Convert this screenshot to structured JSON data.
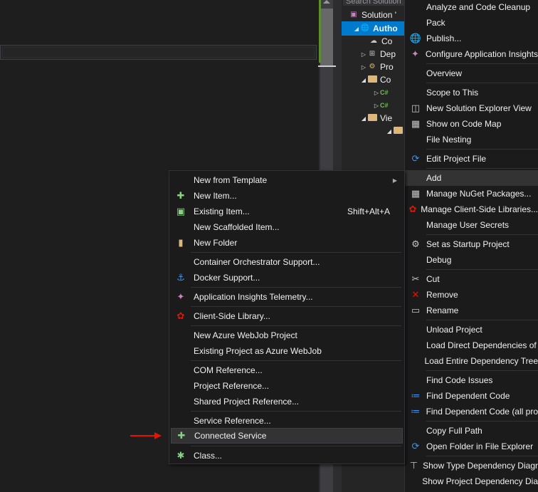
{
  "solution_explorer": {
    "search_placeholder": "Search Solution",
    "rows": [
      {
        "label": "Solution '",
        "indent": 0
      },
      {
        "label": "Autho",
        "indent": 1
      },
      {
        "label": "Co",
        "indent": 2
      },
      {
        "label": "Dep",
        "indent": 2
      },
      {
        "label": "Pro",
        "indent": 2
      },
      {
        "label": "Co",
        "indent": 2
      },
      {
        "label": "C#",
        "indent": 3
      },
      {
        "label": "C#",
        "indent": 3
      },
      {
        "label": "Vie",
        "indent": 2
      },
      {
        "label": "",
        "indent": 3
      }
    ]
  },
  "context_menu": {
    "items": [
      {
        "label": "Analyze and Code Cleanup",
        "icon": ""
      },
      {
        "label": "Pack",
        "icon": ""
      },
      {
        "label": "Publish...",
        "icon": "globe-icon"
      },
      {
        "label": "Configure Application Insights",
        "icon": "app-insights-icon"
      },
      {
        "label": "Overview",
        "icon": ""
      },
      {
        "label": "Scope to This",
        "icon": ""
      },
      {
        "label": "New Solution Explorer View",
        "icon": "new-view-icon"
      },
      {
        "label": "Show on Code Map",
        "icon": "code-map-icon"
      },
      {
        "label": "File Nesting",
        "icon": ""
      },
      {
        "label": "Edit Project File",
        "icon": "edit-refresh-icon"
      },
      {
        "label": "Add",
        "icon": ""
      },
      {
        "label": "Manage NuGet Packages...",
        "icon": "nuget-icon"
      },
      {
        "label": "Manage Client-Side Libraries...",
        "icon": "client-lib-icon"
      },
      {
        "label": "Manage User Secrets",
        "icon": ""
      },
      {
        "label": "Set as Startup Project",
        "icon": "gear-icon"
      },
      {
        "label": "Debug",
        "icon": ""
      },
      {
        "label": "Cut",
        "icon": "scissors-icon"
      },
      {
        "label": "Remove",
        "icon": "close-icon"
      },
      {
        "label": "Rename",
        "icon": "rename-icon"
      },
      {
        "label": "Unload Project",
        "icon": ""
      },
      {
        "label": "Load Direct Dependencies of",
        "icon": ""
      },
      {
        "label": "Load Entire Dependency Tree",
        "icon": ""
      },
      {
        "label": "Find Code Issues",
        "icon": ""
      },
      {
        "label": "Find Dependent Code",
        "icon": "dependent-code-icon"
      },
      {
        "label": "Find Dependent Code (all pro",
        "icon": "dependent-code-icon"
      },
      {
        "label": "Copy Full Path",
        "icon": ""
      },
      {
        "label": "Open Folder in File Explorer",
        "icon": "open-folder-icon"
      },
      {
        "label": "Show Type Dependency Diagr",
        "icon": "type-diagram-icon"
      },
      {
        "label": "Show Project Dependency Dia",
        "icon": ""
      }
    ]
  },
  "add_submenu": {
    "items": [
      {
        "label": "New from Template",
        "shortcut": "",
        "icon": ""
      },
      {
        "label": "New Item...",
        "shortcut": "",
        "icon": "new-item-icon"
      },
      {
        "label": "Existing Item...",
        "shortcut": "Shift+Alt+A",
        "icon": "existing-item-icon"
      },
      {
        "label": "New Scaffolded Item...",
        "shortcut": "",
        "icon": ""
      },
      {
        "label": "New Folder",
        "shortcut": "",
        "icon": "new-folder-icon"
      },
      {
        "label": "Container Orchestrator Support...",
        "shortcut": "",
        "icon": ""
      },
      {
        "label": "Docker Support...",
        "shortcut": "",
        "icon": "docker-icon"
      },
      {
        "label": "Application Insights Telemetry...",
        "shortcut": "",
        "icon": "app-insights-icon"
      },
      {
        "label": "Client-Side Library...",
        "shortcut": "",
        "icon": "client-lib-icon"
      },
      {
        "label": "New Azure WebJob Project",
        "shortcut": "",
        "icon": ""
      },
      {
        "label": "Existing Project as Azure WebJob",
        "shortcut": "",
        "icon": ""
      },
      {
        "label": "COM Reference...",
        "shortcut": "",
        "icon": ""
      },
      {
        "label": "Project Reference...",
        "shortcut": "",
        "icon": ""
      },
      {
        "label": "Shared Project Reference...",
        "shortcut": "",
        "icon": ""
      },
      {
        "label": "Service Reference...",
        "shortcut": "",
        "icon": ""
      },
      {
        "label": "Connected Service",
        "shortcut": "",
        "icon": "connected-service-icon"
      },
      {
        "label": "Class...",
        "shortcut": "",
        "icon": "class-icon"
      }
    ]
  },
  "colors": {
    "menu_bg": "#1b1b1c",
    "highlight_bg": "#333334",
    "selection_blue": "#007acc",
    "annotation_arrow": "#e51400"
  }
}
